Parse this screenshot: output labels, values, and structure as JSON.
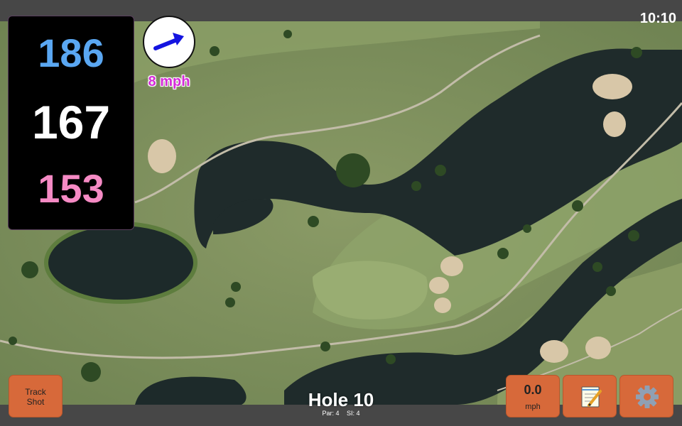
{
  "status": {
    "time": "10:10"
  },
  "distances": {
    "back": "186",
    "center": "167",
    "front": "153",
    "colors": {
      "back": "#5aa7f2",
      "center": "#ffffff",
      "front": "#f58ac4"
    }
  },
  "wind": {
    "speed_label": "8 mph",
    "arrow_icon": "arrow-right-icon",
    "arrow_color": "#1414e0",
    "speed_color": "#d42ad8"
  },
  "hole": {
    "title": "Hole 10",
    "par": "Par: 4",
    "si": "SI: 4"
  },
  "buttons": {
    "track_shot_line1": "Track",
    "track_shot_line2": "Shot",
    "wind_value": "0.0",
    "wind_unit": "mph",
    "notes_icon": "notepad-icon",
    "settings_icon": "gear-icon",
    "button_color": "#d7693a"
  },
  "map": {
    "type": "satellite-course-map",
    "grass_color": "#7a8c5a",
    "water_color": "#1f2b2b"
  }
}
